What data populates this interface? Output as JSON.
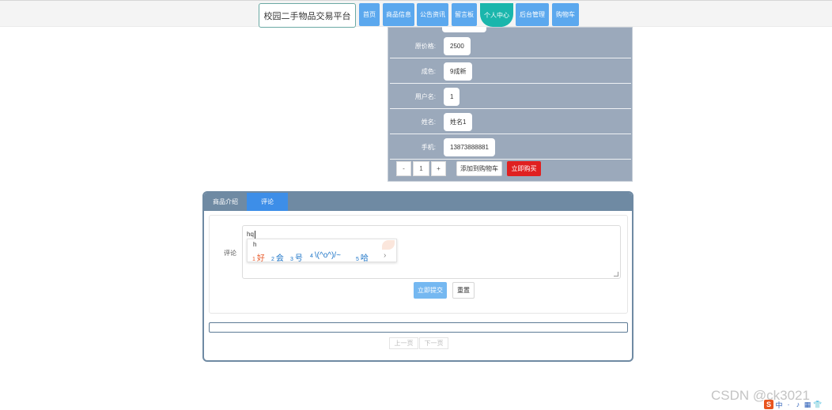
{
  "nav": {
    "brand": "校园二手物品交易平台",
    "items": [
      {
        "label": "首页"
      },
      {
        "label": "商品信息"
      },
      {
        "label": "公告资讯"
      },
      {
        "label": "留言板"
      },
      {
        "label": "个人中心"
      },
      {
        "label": "后台管理"
      },
      {
        "label": "购物车"
      }
    ],
    "active_index": 4
  },
  "detail": {
    "rows": [
      {
        "label": "原价格:",
        "value": "2500"
      },
      {
        "label": "成色:",
        "value": "9成新"
      },
      {
        "label": "用户名:",
        "value": "1"
      },
      {
        "label": "姓名:",
        "value": "姓名1"
      },
      {
        "label": "手机:",
        "value": "13873888881"
      }
    ],
    "quantity": {
      "minus": "-",
      "value": "1",
      "plus": "+"
    },
    "add_to_cart": "添加到购物车",
    "buy_now": "立即购买"
  },
  "tabs": {
    "items": [
      {
        "label": "商品介绍"
      },
      {
        "label": "评论"
      }
    ],
    "active_index": 1
  },
  "comment": {
    "label": "评论",
    "typed_text": "hq",
    "submit": "立即提交",
    "reset": "重置"
  },
  "ime": {
    "pinyin": "h",
    "candidates": [
      {
        "n": "1",
        "text": "好"
      },
      {
        "n": "2",
        "text": "会"
      },
      {
        "n": "3",
        "text": "号"
      },
      {
        "n": "4",
        "text": "\\(^o^)/~"
      },
      {
        "n": "5",
        "text": "哈"
      }
    ],
    "next": "›"
  },
  "pager": {
    "prev": "上一页",
    "next": "下一页"
  },
  "watermark": "CSDN @ck3021",
  "tray": {
    "logo": "S",
    "items": [
      "中",
      "·",
      "♪",
      "▦",
      "👕"
    ]
  },
  "colors": {
    "nav_button": "#5ba8ee",
    "nav_active": "#1ab6ac",
    "panel": "#9ba9bb",
    "tab_header": "#6f8aa3",
    "tab_active": "#3d8ee8",
    "buy_button": "#e02020",
    "submit_button": "#75b8f1"
  }
}
